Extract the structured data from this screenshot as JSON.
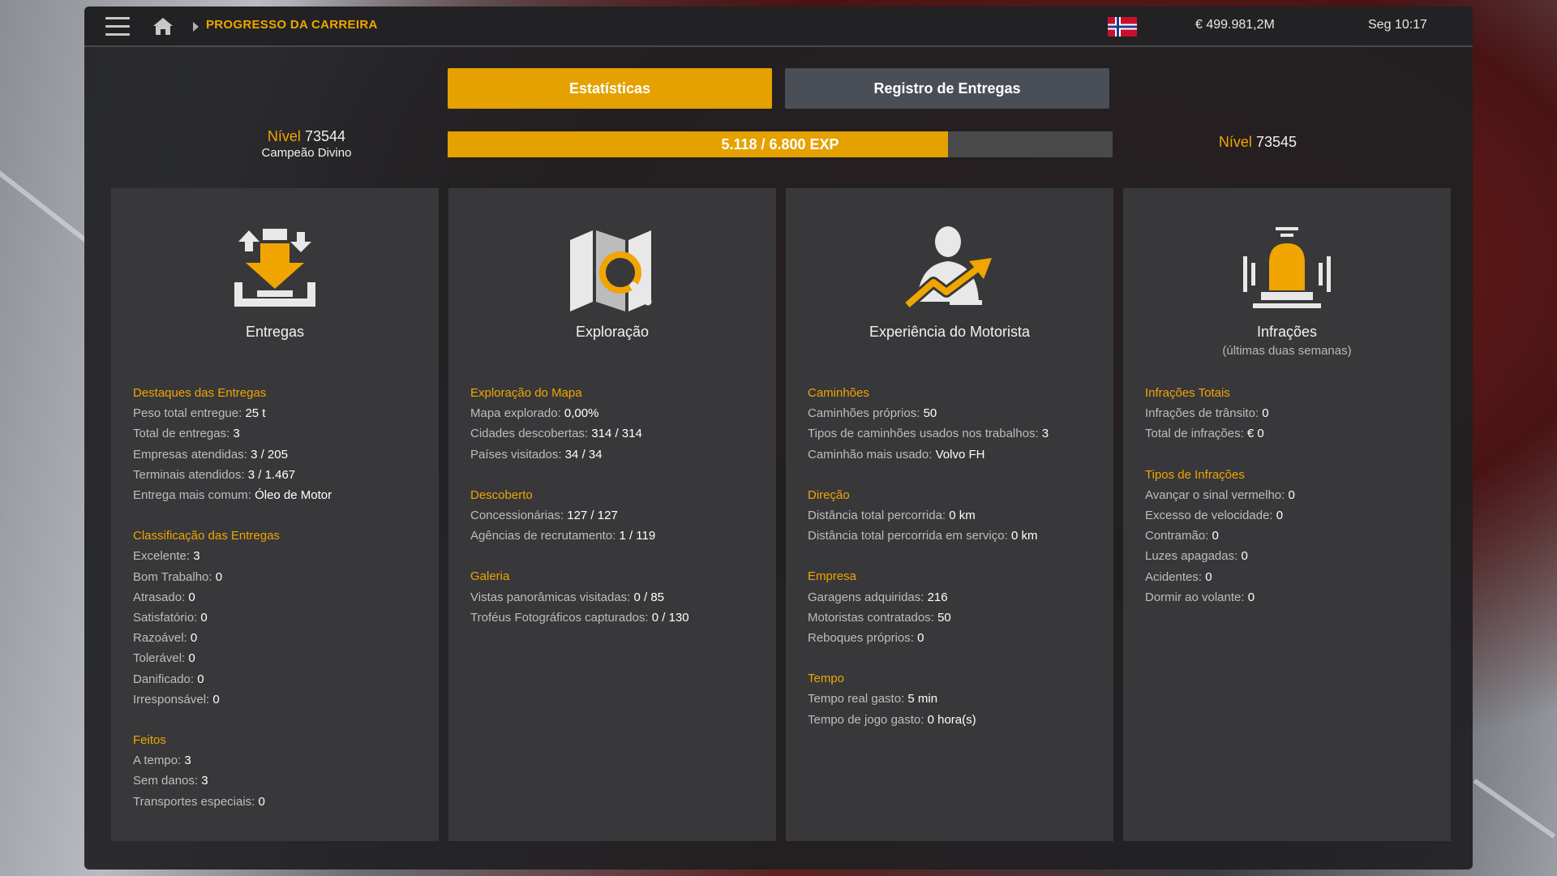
{
  "topbar": {
    "breadcrumb": "PROGRESSO DA CARREIRA",
    "money": "€ 499.981,2M",
    "clock": "Seg 10:17",
    "icons": [
      "menu-icon",
      "home-icon",
      "chevron-right-icon",
      "norway-flag-icon"
    ]
  },
  "tabs": [
    {
      "label": "Estatísticas",
      "active": true
    },
    {
      "label": "Registro de Entregas",
      "active": false
    }
  ],
  "level_current": {
    "word": "Nível",
    "number": "73544",
    "title": "Campeão Divino"
  },
  "level_next": {
    "word": "Nível",
    "number": "73545"
  },
  "xp": {
    "text": "5.118 / 6.800 EXP",
    "current": 5118,
    "max": 6800
  },
  "colors": {
    "accent": "#e5a100",
    "panel": "#38383a",
    "label": "#bdbdbd"
  },
  "cards": [
    {
      "icon": "delivery-icon",
      "title": "Entregas",
      "subtitle": "",
      "sections": [
        {
          "heading": "Destaques das Entregas",
          "rows": [
            {
              "k": "Peso total entregue: ",
              "v": "25 t"
            },
            {
              "k": "Total de entregas: ",
              "v": "3"
            },
            {
              "k": "Empresas atendidas: ",
              "v": "3 / 205"
            },
            {
              "k": "Terminais atendidos: ",
              "v": "3 / 1.467"
            },
            {
              "k": "Entrega mais comum: ",
              "v": "Óleo de Motor"
            }
          ]
        },
        {
          "heading": "Classificação das Entregas",
          "rows": [
            {
              "k": "Excelente: ",
              "v": "3"
            },
            {
              "k": "Bom Trabalho: ",
              "v": "0"
            },
            {
              "k": "Atrasado: ",
              "v": "0"
            },
            {
              "k": "Satisfatório: ",
              "v": "0"
            },
            {
              "k": "Razoável: ",
              "v": "0"
            },
            {
              "k": "Tolerável: ",
              "v": "0"
            },
            {
              "k": "Danificado: ",
              "v": "0"
            },
            {
              "k": "Irresponsável: ",
              "v": "0"
            }
          ]
        },
        {
          "heading": "Feitos",
          "rows": [
            {
              "k": "A tempo: ",
              "v": "3"
            },
            {
              "k": "Sem danos: ",
              "v": "3"
            },
            {
              "k": "Transportes especiais: ",
              "v": "0"
            }
          ]
        }
      ]
    },
    {
      "icon": "map-search-icon",
      "title": "Exploração",
      "subtitle": "",
      "sections": [
        {
          "heading": "Exploração do Mapa",
          "rows": [
            {
              "k": "Mapa explorado: ",
              "v": "0,00%"
            },
            {
              "k": "Cidades descobertas: ",
              "v": "314 / 314"
            },
            {
              "k": "Países visitados: ",
              "v": "34 / 34"
            }
          ]
        },
        {
          "heading": "Descoberto",
          "rows": [
            {
              "k": "Concessionárias: ",
              "v": "127 / 127"
            },
            {
              "k": "Agências de recrutamento: ",
              "v": "1 / 119"
            }
          ]
        },
        {
          "heading": "Galeria",
          "rows": [
            {
              "k": "Vistas panorâmicas visitadas: ",
              "v": "0 / 85"
            },
            {
              "k": "Troféus Fotográficos capturados: ",
              "v": "0 / 130"
            }
          ]
        }
      ]
    },
    {
      "icon": "driver-growth-icon",
      "title": "Experiência do Motorista",
      "subtitle": "",
      "sections": [
        {
          "heading": "Caminhões",
          "rows": [
            {
              "k": "Caminhões próprios: ",
              "v": "50"
            },
            {
              "k": "Tipos de caminhões usados nos trabalhos: ",
              "v": "3"
            },
            {
              "k": "Caminhão mais usado: ",
              "v": "Volvo FH"
            }
          ]
        },
        {
          "heading": "Direção",
          "rows": [
            {
              "k": "Distância total percorrida: ",
              "v": "0 km"
            },
            {
              "k": "Distância total percorrida em serviço: ",
              "v": "0 km"
            }
          ]
        },
        {
          "heading": "Empresa",
          "rows": [
            {
              "k": "Garagens adquiridas: ",
              "v": "216"
            },
            {
              "k": "Motoristas contratados: ",
              "v": "50"
            },
            {
              "k": "Reboques próprios: ",
              "v": "0"
            }
          ]
        },
        {
          "heading": "Tempo",
          "rows": [
            {
              "k": "Tempo real gasto: ",
              "v": "5 min"
            },
            {
              "k": "Tempo de jogo gasto: ",
              "v": "0 hora(s)"
            }
          ]
        }
      ]
    },
    {
      "icon": "siren-icon",
      "title": "Infrações",
      "subtitle": "(últimas duas semanas)",
      "sections": [
        {
          "heading": "Infrações Totais",
          "rows": [
            {
              "k": "Infrações de trânsito: ",
              "v": "0"
            },
            {
              "k": "Total de infrações: ",
              "v": "€ 0"
            }
          ]
        },
        {
          "heading": "Tipos de Infrações",
          "rows": [
            {
              "k": "Avançar o sinal vermelho: ",
              "v": "0"
            },
            {
              "k": "Excesso de velocidade: ",
              "v": "0"
            },
            {
              "k": "Contramão: ",
              "v": "0"
            },
            {
              "k": "Luzes apagadas: ",
              "v": "0"
            },
            {
              "k": "Acidentes: ",
              "v": "0"
            },
            {
              "k": "Dormir ao volante: ",
              "v": "0"
            }
          ]
        }
      ]
    }
  ]
}
